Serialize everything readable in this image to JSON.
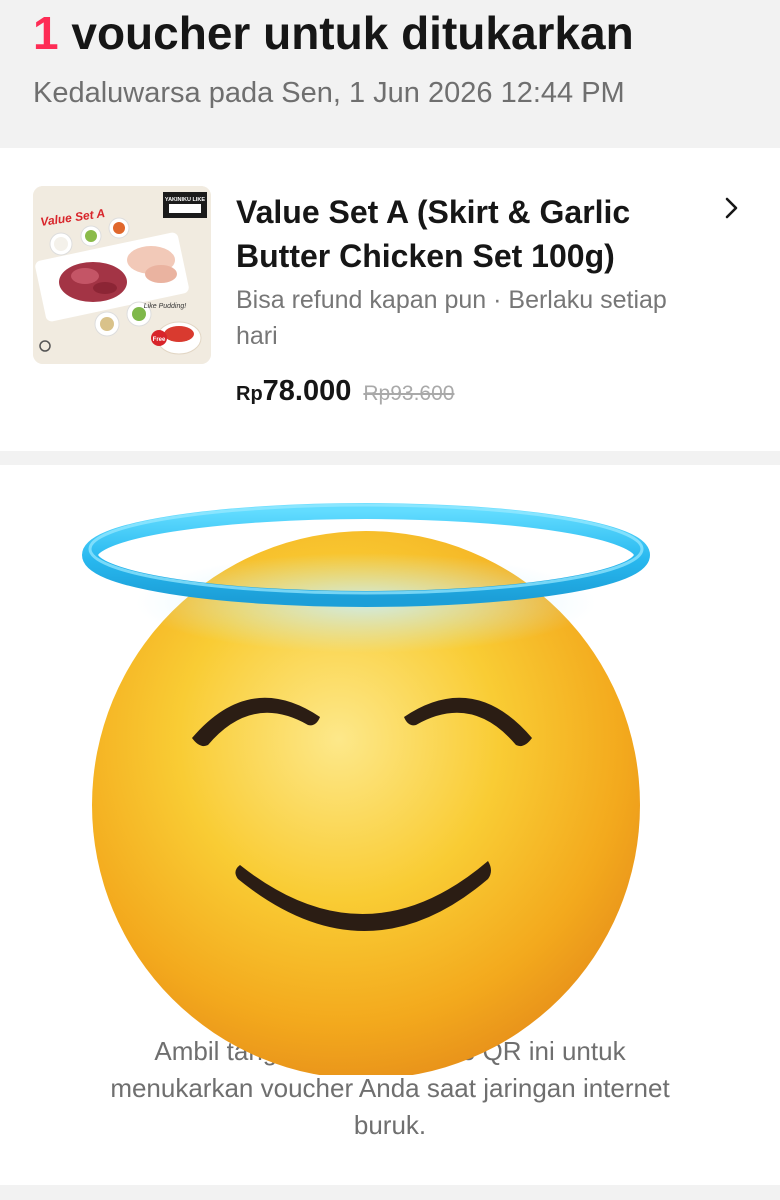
{
  "header": {
    "count": "1",
    "title_rest": "voucher untuk ditukarkan",
    "expiry": "Kedaluwarsa pada Sen, 1 Jun 2026 12:44 PM"
  },
  "voucher": {
    "image_text": {
      "label": "Value Set A",
      "brand": "YAKINIKU LIKE",
      "promo": "Like Pudding!",
      "free": "Free"
    },
    "name_lines": [
      "Value Set A (Skirt & Garlic",
      "Butter Chicken Set 100g)"
    ],
    "sub_lines": [
      "Bisa refund kapan pun · Berlaku setiap",
      "hari"
    ],
    "currency": "Rp",
    "price": "78.000",
    "original_price": "Rp93.600"
  },
  "qr": {
    "tip_lines": [
      "Ambil tangkapan layar kode QR ini untuk",
      "menukarkan voucher Anda saat jaringan internet",
      "buruk."
    ]
  },
  "colors": {
    "accent": "#fe2c55",
    "halo": "#35c7f0",
    "face": "#f7c325"
  },
  "icons": {
    "chevron": "chevron-right-icon",
    "emoji": "smiling-face-with-halo"
  }
}
